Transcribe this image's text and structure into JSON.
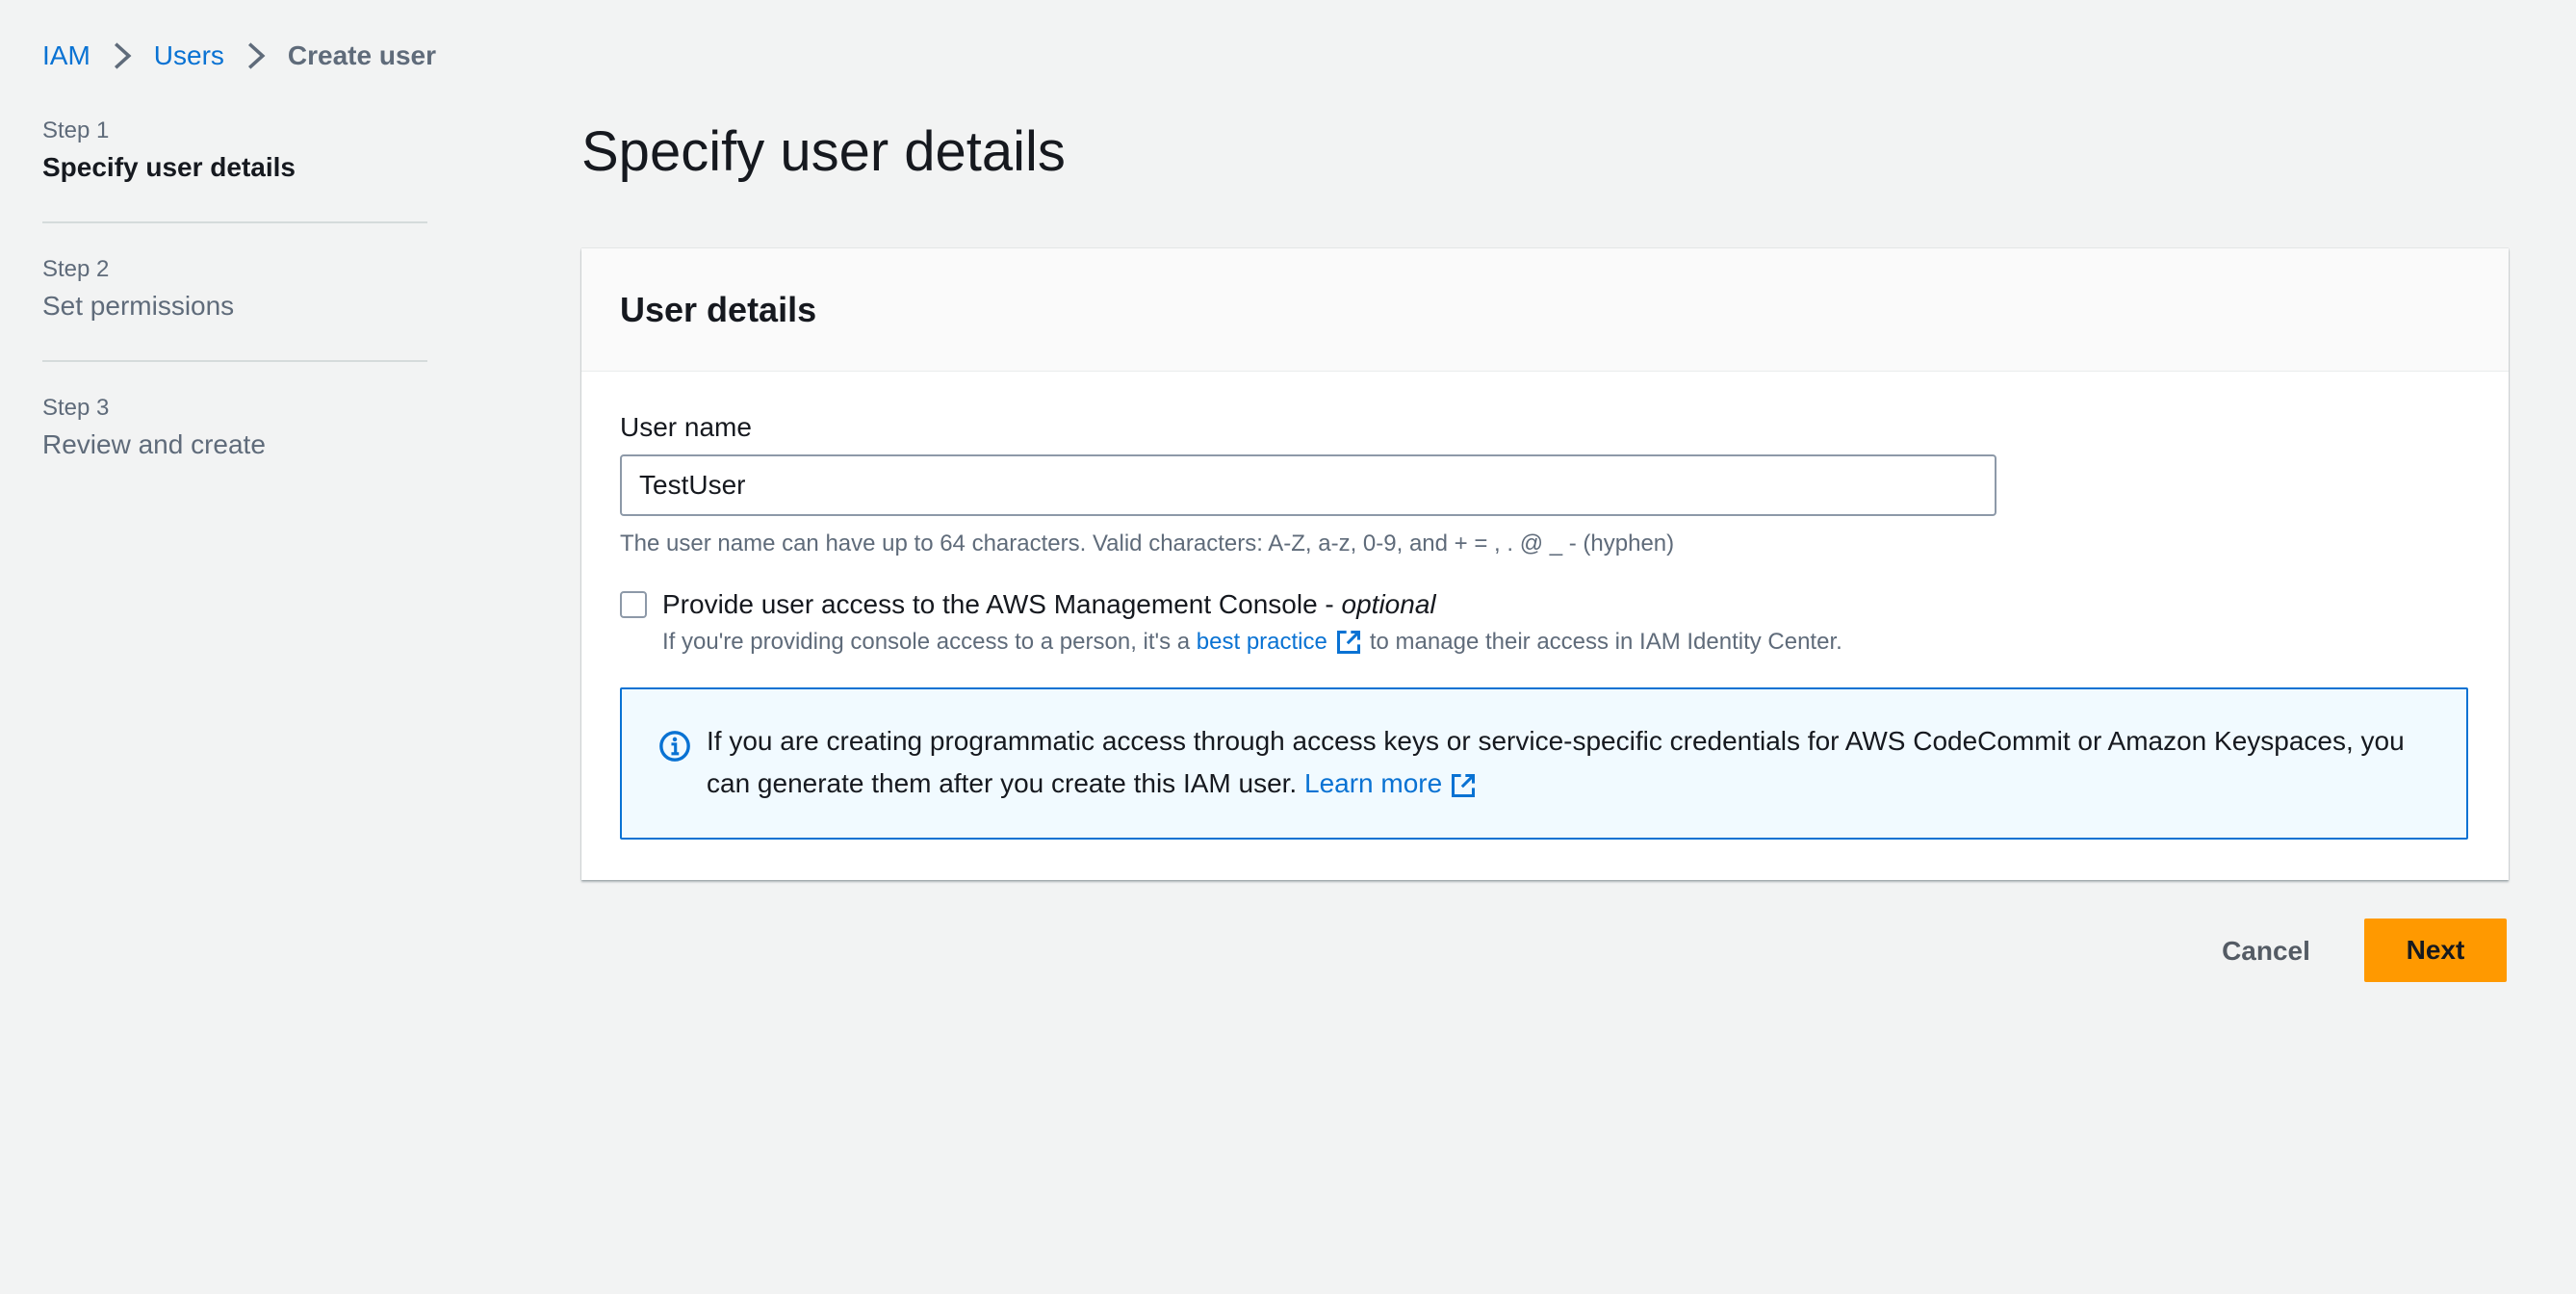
{
  "breadcrumb": {
    "items": [
      {
        "label": "IAM"
      },
      {
        "label": "Users"
      },
      {
        "label": "Create user"
      }
    ],
    "separator_icon": "chevron-right-icon"
  },
  "steps": [
    {
      "number": "Step 1",
      "title": "Specify user details",
      "active": true
    },
    {
      "number": "Step 2",
      "title": "Set permissions",
      "active": false
    },
    {
      "number": "Step 3",
      "title": "Review and create",
      "active": false
    }
  ],
  "page": {
    "title": "Specify user details"
  },
  "user_details": {
    "header": "User details",
    "user_name_label": "User name",
    "user_name_value": "TestUser",
    "user_name_constraint": "The user name can have up to 64 characters. Valid characters: A-Z, a-z, 0-9, and + = , . @ _ - (hyphen)",
    "console_access": {
      "label": "Provide user access to the AWS Management Console - ",
      "optional": "optional",
      "checked": false,
      "desc_prefix": "If you're providing console access to a person, it's a",
      "desc_link": "best practice",
      "desc_suffix": "to manage their access in IAM Identity Center."
    },
    "info_alert": {
      "text": "If you are creating programmatic access through access keys or service-specific credentials for AWS CodeCommit or Amazon Keyspaces, you can generate them after you create this IAM user.",
      "link": "Learn more",
      "icon": "info-icon"
    }
  },
  "actions": {
    "cancel_label": "Cancel",
    "next_label": "Next"
  },
  "colors": {
    "link": "#0972d3",
    "primary_button": "#ff9900",
    "background": "#f2f3f3",
    "alert_border": "#0972d3",
    "alert_background": "#f1faff"
  }
}
